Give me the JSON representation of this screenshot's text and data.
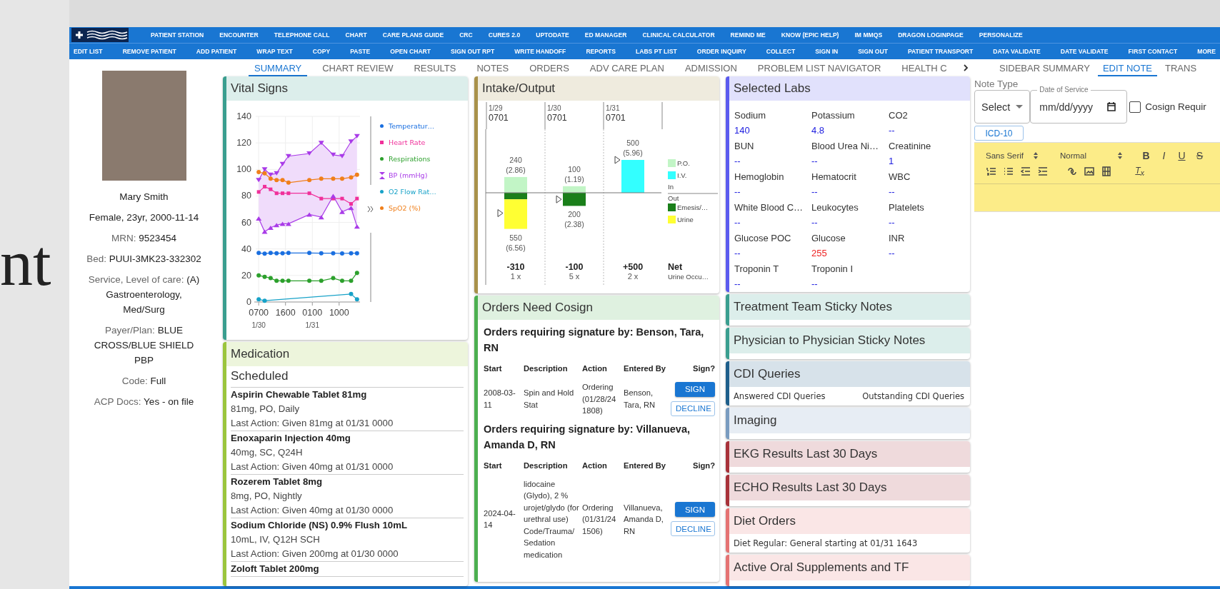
{
  "background_text": "nt",
  "toolbar": {
    "row1": [
      "PATIENT STATION",
      "ENCOUNTER",
      "TELEPHONE CALL",
      "CHART",
      "CARE PLANS GUIDE",
      "CRC",
      "CURES 2.0",
      "UPTODATE",
      "ED MANAGER",
      "CLINICAL CALCULATOR",
      "REMIND ME",
      "KNOW (EPIC HELP)",
      "IM MMQS",
      "DRAGON LOGINPAGE",
      "PERSONALIZE"
    ],
    "row2": [
      "EDIT LIST",
      "REMOVE PATIENT",
      "ADD PATIENT",
      "WRAP TEXT",
      "COPY",
      "PASTE",
      "OPEN CHART",
      "SIGN OUT RPT",
      "WRITE HANDOFF",
      "REPORTS",
      "LABS PT LIST",
      "ORDER INQUIRY",
      "COLLECT",
      "SIGN IN",
      "SIGN OUT",
      "PATIENT TRANSPORT",
      "DATA VALIDATE",
      "DATE VALIDATE",
      "FIRST CONTACT",
      "MORE"
    ]
  },
  "patient": {
    "name": "Mary Smith",
    "demographics": "Female, 23yr, 2000-11-14",
    "fields": [
      {
        "label": "MRN: ",
        "value": "9523454"
      },
      {
        "label": "Bed: ",
        "value": "PUUI-3MK23-332302"
      },
      {
        "label": "Service, Level of care: ",
        "value": "(A) Gastroenterology, Med/Surg"
      },
      {
        "label": "Payer/Plan: ",
        "value": "BLUE CROSS/BLUE SHIELD PBP"
      },
      {
        "label": "Code: ",
        "value": "Full"
      },
      {
        "label": "ACP Docs: ",
        "value": "Yes - on file"
      }
    ]
  },
  "main_tabs": [
    {
      "label": "SUMMARY",
      "selected": true
    },
    {
      "label": "CHART REVIEW",
      "selected": false
    },
    {
      "label": "RESULTS",
      "selected": false
    },
    {
      "label": "NOTES",
      "selected": false
    },
    {
      "label": "ORDERS",
      "selected": false
    },
    {
      "label": "ADV CARE PLAN",
      "selected": false
    },
    {
      "label": "ADMISSION",
      "selected": false
    },
    {
      "label": "PROBLEM LIST NAVIGATOR",
      "selected": false
    },
    {
      "label": "HEALTH C",
      "selected": false
    }
  ],
  "vital_signs": {
    "title": "Vital Signs",
    "color": "#3a9e8f",
    "date_labels": [
      "1/30",
      "1/31"
    ],
    "chart_data": {
      "type": "line",
      "grid": true,
      "ylim": [
        0,
        140
      ],
      "yticks": [
        0,
        20,
        40,
        60,
        80,
        100,
        120,
        140
      ],
      "categories": [
        "0700",
        null,
        null,
        null,
        null,
        null,
        null,
        null,
        null,
        "1600",
        null,
        null,
        null,
        null,
        null,
        null,
        null,
        null,
        "0100",
        null,
        null,
        null,
        null,
        null,
        null,
        null,
        null,
        "1000",
        null,
        null,
        null,
        null,
        null,
        null
      ],
      "series": [
        {
          "name": "Temperatur…",
          "color": "#1a6fe0",
          "marker": "circle",
          "values": [
            37,
            null,
            36.5,
            null,
            37,
            null,
            36.8,
            null,
            36.8,
            null,
            37,
            null,
            null,
            null,
            null,
            null,
            null,
            37,
            null,
            null,
            null,
            36.8,
            null,
            null,
            null,
            36.8,
            null,
            null,
            36.6,
            null,
            null,
            36.8,
            null,
            36.8
          ]
        },
        {
          "name": "Heart Rate",
          "color": "#f0309a",
          "marker": "square",
          "values": [
            83,
            null,
            87,
            null,
            85,
            null,
            82,
            null,
            82,
            null,
            82,
            null,
            null,
            null,
            null,
            null,
            null,
            82,
            null,
            null,
            null,
            78,
            null,
            null,
            null,
            78,
            null,
            null,
            78,
            null,
            null,
            74,
            null,
            78
          ]
        },
        {
          "name": "Respirations",
          "color": "#2ca02c",
          "marker": "circle",
          "values": [
            20,
            null,
            19,
            null,
            18,
            null,
            16,
            null,
            16,
            null,
            16,
            null,
            null,
            null,
            null,
            null,
            null,
            16,
            null,
            null,
            null,
            16,
            null,
            null,
            null,
            18,
            null,
            null,
            16,
            null,
            null,
            16,
            null,
            22
          ]
        },
        {
          "name": "BP (mmHg)",
          "color": "#a93be8",
          "marker": "triangle-down",
          "values": [
            92,
            null,
            100,
            null,
            96,
            null,
            97,
            null,
            104,
            null,
            110,
            null,
            null,
            null,
            null,
            null,
            null,
            112,
            null,
            null,
            null,
            120,
            null,
            null,
            null,
            111,
            null,
            null,
            110,
            null,
            null,
            121,
            null,
            125
          ]
        },
        {
          "color": "#a93be8",
          "marker": "triangle-up",
          "values": [
            63,
            null,
            53,
            null,
            56,
            null,
            58,
            null,
            59,
            null,
            59,
            null,
            null,
            null,
            null,
            null,
            null,
            66,
            null,
            null,
            null,
            64,
            null,
            null,
            null,
            80,
            null,
            null,
            68,
            null,
            null,
            71,
            null,
            57
          ]
        },
        {
          "name": "O2 Flow Rat…",
          "color": "#17a2c8",
          "marker": "circle",
          "values": [
            2,
            null,
            1,
            null,
            null,
            null,
            null,
            null,
            null,
            null,
            null,
            null,
            null,
            null,
            null,
            null,
            null,
            null,
            null,
            null,
            null,
            null,
            null,
            null,
            null,
            null,
            null,
            null,
            null,
            null,
            null,
            6,
            null,
            2
          ]
        },
        {
          "name": "SpO2 (%)",
          "color": "#f07f1a",
          "marker": "circle",
          "values": [
            98,
            null,
            97,
            null,
            93,
            null,
            92,
            null,
            92,
            null,
            90,
            null,
            null,
            null,
            null,
            null,
            null,
            92,
            null,
            null,
            null,
            93,
            null,
            null,
            null,
            93,
            null,
            null,
            93,
            null,
            null,
            94,
            null,
            96
          ]
        }
      ]
    }
  },
  "medication": {
    "title": "Medication",
    "color": "#9bc53d",
    "section": "Scheduled",
    "items": [
      {
        "name": "Aspirin Chewable Tablet 81mg",
        "dose": "81mg, PO, Daily",
        "last_action": "Last Action: Given 81mg at 01/31 0000"
      },
      {
        "name": "Enoxaparin Injection 40mg",
        "dose": "40mg, SC, Q24H",
        "last_action": "Last Action: Given 40mg at 01/31 0000"
      },
      {
        "name": "Rozerem Tablet 8mg",
        "dose": "8mg, PO, Nightly",
        "last_action": "Last Action: Given 40mg at 01/30 0000"
      },
      {
        "name": "Sodium Chloride (NS) 0.9% Flush 10mL",
        "dose": "10mL, IV, Q12H SCH",
        "last_action": "Last Action: Given 200mg at 01/30 0000"
      },
      {
        "name": "Zoloft Tablet 200mg"
      }
    ]
  },
  "intake_output": {
    "title": "Intake/Output",
    "color": "#a8914a",
    "in_label": "In",
    "out_label": "Out",
    "net_label": "Net",
    "net_sub": "Urine Occu…",
    "columns": [
      {
        "time": "0701",
        "in_sub": "(2.86)",
        "out_total": "550",
        "out_sub": "(6.56)",
        "count": "1 x"
      },
      {
        "time": "0701",
        "in_sub": "(1.19)",
        "out_total": "200",
        "out_sub": "(2.38)",
        "count": "5 x"
      },
      {
        "time": "0701",
        "in_sub": "(5.96)",
        "count": "2 x"
      }
    ],
    "chart_data": {
      "type": "bar",
      "stacked": true,
      "legend": "right",
      "categories": [
        "1/29",
        "1/30",
        "1/31"
      ],
      "series": [
        {
          "name": "P.O.",
          "color": "#c2f5c6",
          "values": [
            240,
            100,
            null
          ],
          "value_labels": [
            "240",
            "100",
            null
          ]
        },
        {
          "name": "I.V.",
          "color": "#33ffff",
          "values": [
            null,
            null,
            500
          ],
          "value_labels": [
            null,
            null,
            "500"
          ]
        },
        {
          "name": "Emesis/…",
          "color": "#1a7f1a",
          "values": [
            -100,
            -200,
            null
          ]
        },
        {
          "name": "Urine",
          "color": "#ffff33",
          "values": [
            -450,
            null,
            null
          ]
        }
      ],
      "annotations": [
        "-310",
        "-100",
        "+500"
      ]
    }
  },
  "orders_cosign": {
    "title": "Orders Need Cosign",
    "color": "#4caf50",
    "groups": [
      {
        "heading": "Orders requiring signature by: Benson, Tara, RN",
        "columns": [
          "Start",
          "Description",
          "Action",
          "Entered By",
          "Sign?"
        ],
        "rows": [
          {
            "start": "2008-03-11",
            "description": "Spin and Hold Stat",
            "action": "Ordering (01/28/24 1808)",
            "entered_by": "Benson, Tara, RN",
            "sign": "SIGN",
            "decline": "DECLINE"
          }
        ]
      },
      {
        "heading": "Orders requiring signature by: Villanueva, Amanda D, RN",
        "columns": [
          "Start",
          "Description",
          "Action",
          "Entered By",
          "Sign?"
        ],
        "rows": [
          {
            "start": "2024-04-14",
            "description": "lidocaine (Glydo), 2 % urojet/glydo (for urethral use) Code/Trauma/ Sedation medication",
            "action": "Ordering (01/31/24 1506)",
            "entered_by": "Villanueva, Amanda D, RN",
            "sign": "SIGN",
            "decline": "DECLINE"
          }
        ]
      }
    ]
  },
  "labs": {
    "title": "Selected Labs",
    "color": "#5b5bef",
    "items": [
      {
        "name": "Sodium",
        "value": "140",
        "abnormal": false
      },
      {
        "name": "Potassium",
        "value": "4.8",
        "abnormal": false
      },
      {
        "name": "CO2",
        "value": "--",
        "abnormal": false
      },
      {
        "name": "BUN",
        "value": "--",
        "abnormal": false
      },
      {
        "name": "Blood Urea Ni…",
        "value": "--",
        "abnormal": false
      },
      {
        "name": "Creatinine",
        "value": "1",
        "abnormal": false
      },
      {
        "name": "Hemoglobin",
        "value": "--",
        "abnormal": false
      },
      {
        "name": "Hematocrit",
        "value": "--",
        "abnormal": false
      },
      {
        "name": "WBC",
        "value": "--",
        "abnormal": false
      },
      {
        "name": "White Blood C…",
        "value": "--",
        "abnormal": false
      },
      {
        "name": "Leukocytes",
        "value": "--",
        "abnormal": false
      },
      {
        "name": "Platelets",
        "value": "--",
        "abnormal": false
      },
      {
        "name": "Glucose POC",
        "value": "--",
        "abnormal": false
      },
      {
        "name": "Glucose",
        "value": "255",
        "abnormal": true
      },
      {
        "name": "INR",
        "value": "--",
        "abnormal": false
      },
      {
        "name": "Troponin T",
        "value": "--",
        "abnormal": false
      },
      {
        "name": "Troponin I",
        "value": "--",
        "abnormal": false
      }
    ]
  },
  "side_cards": [
    {
      "title": "Treatment Team Sticky Notes",
      "color": "#3a9e8f"
    },
    {
      "title": "Physician to Physician Sticky Notes",
      "color": "#3a9e8f"
    },
    {
      "title": "CDI Queries",
      "color": "#1f5f8b",
      "body": [
        "Answered CDI Queries",
        "Outstanding CDI Queries"
      ]
    },
    {
      "title": "Imaging",
      "color": "#7a9cc0"
    },
    {
      "title": "EKG Results Last 30 Days",
      "color": "#a8323a"
    },
    {
      "title": "ECHO Results Last 30 Days",
      "color": "#a8323a"
    },
    {
      "title": "Diet Orders",
      "color": "#e57373",
      "body": [
        "Diet Regular: General starting at 01/31 1643"
      ]
    },
    {
      "title": "Active Oral Supplements and TF",
      "color": "#e57373"
    }
  ],
  "side_tabs": [
    {
      "label": "SIDEBAR SUMMARY",
      "selected": false
    },
    {
      "label": "EDIT NOTE",
      "selected": true
    },
    {
      "label": "TRANS",
      "selected": false
    }
  ],
  "edit_note": {
    "note_type_label": "Note Type",
    "note_type_value": "Select",
    "date_label": "Date of Service",
    "date_placeholder": "mm/dd/yyyy",
    "cosign": {
      "label": "Cosign Requir",
      "checked": false
    },
    "icd_button": "ICD-10",
    "font_select": "Sans Serif",
    "size_select": "Normal",
    "format_buttons": [
      {
        "label": "B",
        "kind": "bold"
      },
      {
        "label": "I",
        "kind": "italic"
      },
      {
        "label": "U",
        "kind": "underline"
      },
      {
        "label": "S",
        "kind": "strike"
      }
    ],
    "clear_button": "T$_{x}$"
  }
}
